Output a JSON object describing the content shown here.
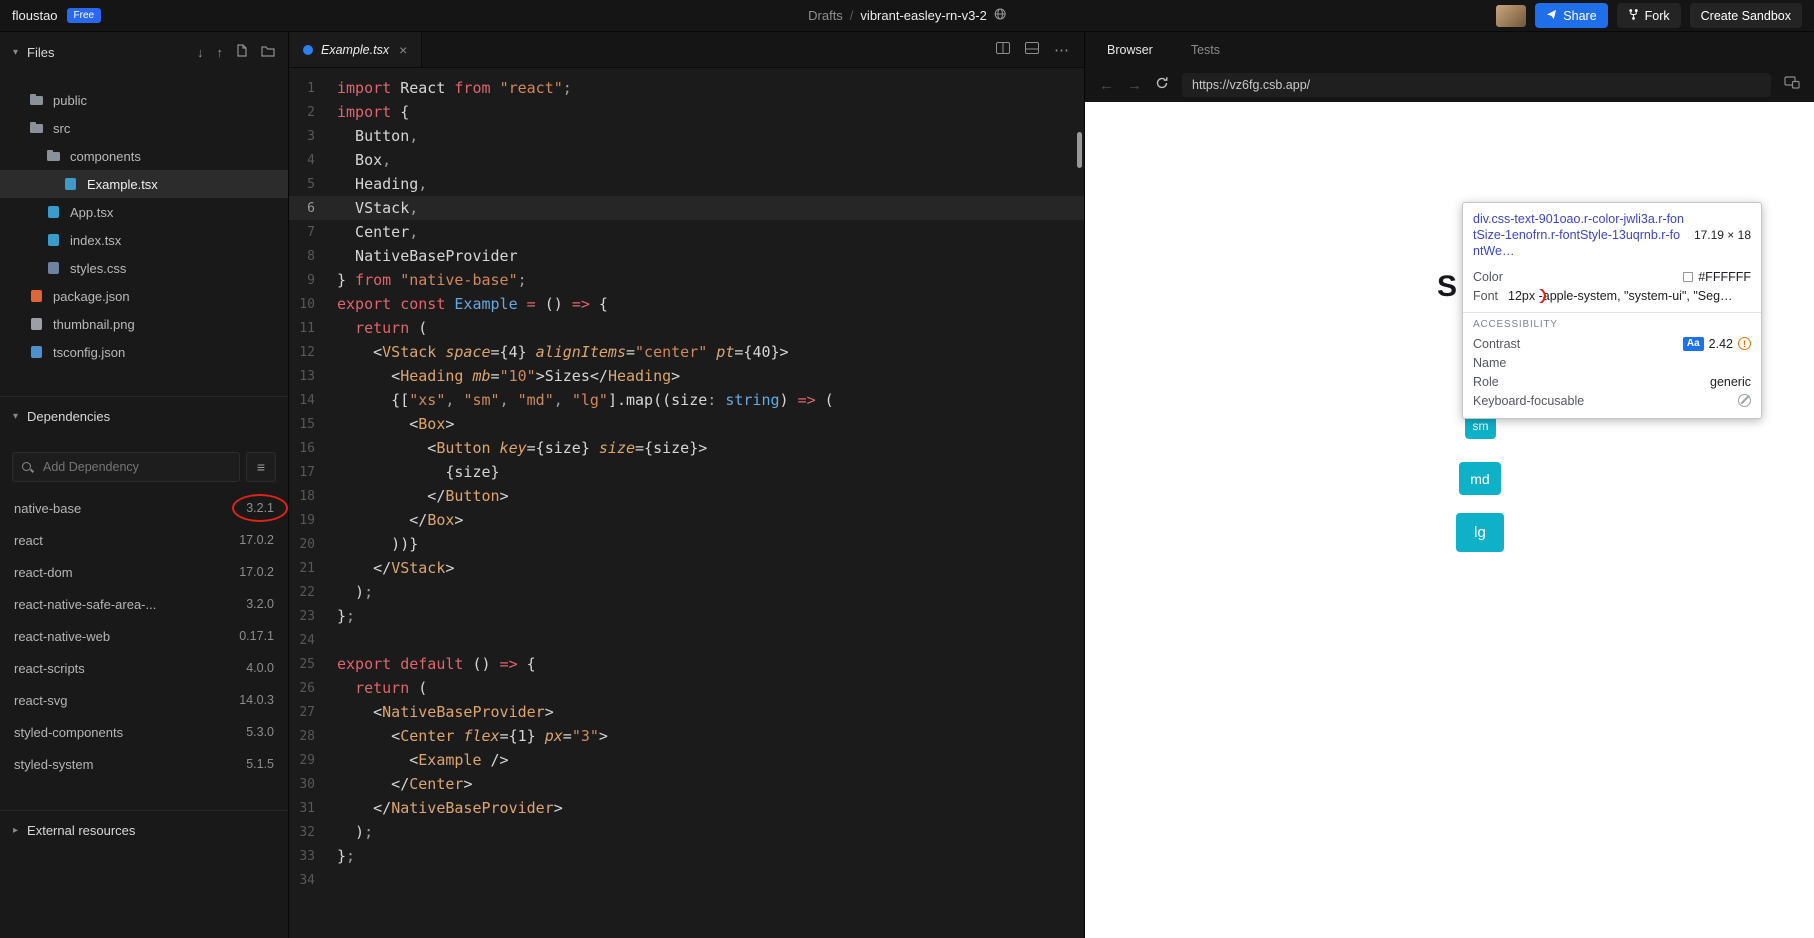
{
  "colors": {
    "accent_blue": "#1f6feb",
    "badge_blue": "#2868f3",
    "button_teal": "#0eb1c7",
    "annotation_red": "#dd2418",
    "selector_blue": "#3b46c4"
  },
  "icons": {
    "chevron_down": "▾",
    "chevron_right": "▸",
    "download": "↓",
    "upload": "↑",
    "menu": "≡",
    "close": "×",
    "more": "⋯",
    "back": "←",
    "forward": "→",
    "warning": "!"
  },
  "topbar": {
    "logo": "floustao",
    "plan_badge": "Free",
    "breadcrumb_parent": "Drafts",
    "breadcrumb_sep": "/",
    "breadcrumb_name": "vibrant-easley-rn-v3-2",
    "share_label": "Share",
    "fork_label": "Fork",
    "create_label": "Create Sandbox"
  },
  "sidebar": {
    "files_header": "Files",
    "files": [
      {
        "label": "public",
        "icon": "folder-icon",
        "indent": 1
      },
      {
        "label": "src",
        "icon": "folder-icon",
        "indent": 1
      },
      {
        "label": "components",
        "icon": "folder-icon",
        "indent": 2
      },
      {
        "label": "Example.tsx",
        "icon": "tsx-file-icon",
        "indent": 3,
        "selected": true
      },
      {
        "label": "App.tsx",
        "icon": "tsx-file-icon",
        "indent": 2
      },
      {
        "label": "index.tsx",
        "icon": "tsx-file-icon",
        "indent": 2
      },
      {
        "label": "styles.css",
        "icon": "css-file-icon",
        "indent": 2
      },
      {
        "label": "package.json",
        "icon": "json-file-icon",
        "indent": 1
      },
      {
        "label": "thumbnail.png",
        "icon": "image-file-icon",
        "indent": 1
      },
      {
        "label": "tsconfig.json",
        "icon": "config-file-icon",
        "indent": 1
      }
    ],
    "dependencies_header": "Dependencies",
    "add_dependency_placeholder": "Add Dependency",
    "dependencies": [
      {
        "name": "native-base",
        "version": "3.2.1",
        "annotated": true
      },
      {
        "name": "react",
        "version": "17.0.2"
      },
      {
        "name": "react-dom",
        "version": "17.0.2"
      },
      {
        "name": "react-native-safe-area-...",
        "version": "3.2.0"
      },
      {
        "name": "react-native-web",
        "version": "0.17.1"
      },
      {
        "name": "react-scripts",
        "version": "4.0.0"
      },
      {
        "name": "react-svg",
        "version": "14.0.3"
      },
      {
        "name": "styled-components",
        "version": "5.3.0"
      },
      {
        "name": "styled-system",
        "version": "5.1.5"
      }
    ],
    "external_resources_header": "External resources"
  },
  "editor": {
    "tab_title": "Example.tsx",
    "active_line": 6,
    "code_lines": [
      {
        "n": 1,
        "tokens": [
          {
            "c": "kw",
            "t": "import"
          },
          {
            "c": "pln",
            "t": " React "
          },
          {
            "c": "kw",
            "t": "from"
          },
          {
            "c": "pln",
            "t": " "
          },
          {
            "c": "str",
            "t": "\"react\""
          },
          {
            "c": "pun",
            "t": ";"
          }
        ]
      },
      {
        "n": 2,
        "tokens": [
          {
            "c": "kw",
            "t": "import"
          },
          {
            "c": "pln",
            "t": " {"
          }
        ]
      },
      {
        "n": 3,
        "tokens": [
          {
            "c": "pln",
            "t": "  Button"
          },
          {
            "c": "pun",
            "t": ","
          }
        ]
      },
      {
        "n": 4,
        "tokens": [
          {
            "c": "pln",
            "t": "  Box"
          },
          {
            "c": "pun",
            "t": ","
          }
        ]
      },
      {
        "n": 5,
        "tokens": [
          {
            "c": "pln",
            "t": "  Heading"
          },
          {
            "c": "pun",
            "t": ","
          }
        ]
      },
      {
        "n": 6,
        "tokens": [
          {
            "c": "pln",
            "t": "  VStack"
          },
          {
            "c": "pun",
            "t": ","
          }
        ]
      },
      {
        "n": 7,
        "tokens": [
          {
            "c": "pln",
            "t": "  Center"
          },
          {
            "c": "pun",
            "t": ","
          }
        ]
      },
      {
        "n": 8,
        "tokens": [
          {
            "c": "pln",
            "t": "  NativeBaseProvider"
          }
        ]
      },
      {
        "n": 9,
        "tokens": [
          {
            "c": "pln",
            "t": "} "
          },
          {
            "c": "kw",
            "t": "from"
          },
          {
            "c": "pln",
            "t": " "
          },
          {
            "c": "str",
            "t": "\"native-base\""
          },
          {
            "c": "pun",
            "t": ";"
          }
        ]
      },
      {
        "n": 10,
        "tokens": [
          {
            "c": "kw",
            "t": "export"
          },
          {
            "c": "pln",
            "t": " "
          },
          {
            "c": "kw",
            "t": "const"
          },
          {
            "c": "pln",
            "t": " "
          },
          {
            "c": "typ",
            "t": "Example"
          },
          {
            "c": "pln",
            "t": " "
          },
          {
            "c": "kw",
            "t": "="
          },
          {
            "c": "pln",
            "t": " () "
          },
          {
            "c": "kw",
            "t": "=>"
          },
          {
            "c": "pln",
            "t": " {"
          }
        ]
      },
      {
        "n": 11,
        "tokens": [
          {
            "c": "pln",
            "t": "  "
          },
          {
            "c": "kw",
            "t": "return"
          },
          {
            "c": "pln",
            "t": " ("
          }
        ]
      },
      {
        "n": 12,
        "tokens": [
          {
            "c": "pln",
            "t": "    <"
          },
          {
            "c": "tag",
            "t": "VStack"
          },
          {
            "c": "att",
            "t": " space"
          },
          {
            "c": "pln",
            "t": "={"
          },
          {
            "c": "num",
            "t": "4"
          },
          {
            "c": "pln",
            "t": "}"
          },
          {
            "c": "att",
            "t": " alignItems"
          },
          {
            "c": "pln",
            "t": "="
          },
          {
            "c": "str",
            "t": "\"center\""
          },
          {
            "c": "att",
            "t": " pt"
          },
          {
            "c": "pln",
            "t": "={"
          },
          {
            "c": "num",
            "t": "40"
          },
          {
            "c": "pln",
            "t": "}>"
          }
        ]
      },
      {
        "n": 13,
        "tokens": [
          {
            "c": "pln",
            "t": "      <"
          },
          {
            "c": "tag",
            "t": "Heading"
          },
          {
            "c": "att",
            "t": " mb"
          },
          {
            "c": "pln",
            "t": "="
          },
          {
            "c": "str",
            "t": "\"10\""
          },
          {
            "c": "pln",
            "t": ">Sizes</"
          },
          {
            "c": "tag",
            "t": "Heading"
          },
          {
            "c": "pln",
            "t": ">"
          }
        ]
      },
      {
        "n": 14,
        "tokens": [
          {
            "c": "pln",
            "t": "      {["
          },
          {
            "c": "str",
            "t": "\"xs\""
          },
          {
            "c": "pun",
            "t": ", "
          },
          {
            "c": "str",
            "t": "\"sm\""
          },
          {
            "c": "pun",
            "t": ", "
          },
          {
            "c": "str",
            "t": "\"md\""
          },
          {
            "c": "pun",
            "t": ", "
          },
          {
            "c": "str",
            "t": "\"lg\""
          },
          {
            "c": "pln",
            "t": "].map((size"
          },
          {
            "c": "pun",
            "t": ": "
          },
          {
            "c": "typ",
            "t": "string"
          },
          {
            "c": "pln",
            "t": ") "
          },
          {
            "c": "kw",
            "t": "=>"
          },
          {
            "c": "pln",
            "t": " ("
          }
        ]
      },
      {
        "n": 15,
        "tokens": [
          {
            "c": "pln",
            "t": "        <"
          },
          {
            "c": "tag",
            "t": "Box"
          },
          {
            "c": "pln",
            "t": ">"
          }
        ]
      },
      {
        "n": 16,
        "tokens": [
          {
            "c": "pln",
            "t": "          <"
          },
          {
            "c": "tag",
            "t": "Button"
          },
          {
            "c": "att",
            "t": " key"
          },
          {
            "c": "pln",
            "t": "={size}"
          },
          {
            "c": "att",
            "t": " size"
          },
          {
            "c": "pln",
            "t": "={size}>"
          }
        ]
      },
      {
        "n": 17,
        "tokens": [
          {
            "c": "pln",
            "t": "            {size}"
          }
        ]
      },
      {
        "n": 18,
        "tokens": [
          {
            "c": "pln",
            "t": "          </"
          },
          {
            "c": "tag",
            "t": "Button"
          },
          {
            "c": "pln",
            "t": ">"
          }
        ]
      },
      {
        "n": 19,
        "tokens": [
          {
            "c": "pln",
            "t": "        </"
          },
          {
            "c": "tag",
            "t": "Box"
          },
          {
            "c": "pln",
            "t": ">"
          }
        ]
      },
      {
        "n": 20,
        "tokens": [
          {
            "c": "pln",
            "t": "      ))}"
          }
        ]
      },
      {
        "n": 21,
        "tokens": [
          {
            "c": "pln",
            "t": "    </"
          },
          {
            "c": "tag",
            "t": "VStack"
          },
          {
            "c": "pln",
            "t": ">"
          }
        ]
      },
      {
        "n": 22,
        "tokens": [
          {
            "c": "pln",
            "t": "  )"
          },
          {
            "c": "pun",
            "t": ";"
          }
        ]
      },
      {
        "n": 23,
        "tokens": [
          {
            "c": "pln",
            "t": "}"
          },
          {
            "c": "pun",
            "t": ";"
          }
        ]
      },
      {
        "n": 24,
        "tokens": []
      },
      {
        "n": 25,
        "tokens": [
          {
            "c": "kw",
            "t": "export"
          },
          {
            "c": "pln",
            "t": " "
          },
          {
            "c": "kw",
            "t": "default"
          },
          {
            "c": "pln",
            "t": " () "
          },
          {
            "c": "kw",
            "t": "=>"
          },
          {
            "c": "pln",
            "t": " {"
          }
        ]
      },
      {
        "n": 26,
        "tokens": [
          {
            "c": "pln",
            "t": "  "
          },
          {
            "c": "kw",
            "t": "return"
          },
          {
            "c": "pln",
            "t": " ("
          }
        ]
      },
      {
        "n": 27,
        "tokens": [
          {
            "c": "pln",
            "t": "    <"
          },
          {
            "c": "tag",
            "t": "NativeBaseProvider"
          },
          {
            "c": "pln",
            "t": ">"
          }
        ]
      },
      {
        "n": 28,
        "tokens": [
          {
            "c": "pln",
            "t": "      <"
          },
          {
            "c": "tag",
            "t": "Center"
          },
          {
            "c": "att",
            "t": " flex"
          },
          {
            "c": "pln",
            "t": "={"
          },
          {
            "c": "num",
            "t": "1"
          },
          {
            "c": "pln",
            "t": "}"
          },
          {
            "c": "att",
            "t": " px"
          },
          {
            "c": "pln",
            "t": "="
          },
          {
            "c": "str",
            "t": "\"3\""
          },
          {
            "c": "pln",
            "t": ">"
          }
        ]
      },
      {
        "n": 29,
        "tokens": [
          {
            "c": "pln",
            "t": "        <"
          },
          {
            "c": "tag",
            "t": "Example"
          },
          {
            "c": "pln",
            "t": " />"
          }
        ]
      },
      {
        "n": 30,
        "tokens": [
          {
            "c": "pln",
            "t": "      </"
          },
          {
            "c": "tag",
            "t": "Center"
          },
          {
            "c": "pln",
            "t": ">"
          }
        ]
      },
      {
        "n": 31,
        "tokens": [
          {
            "c": "pln",
            "t": "    </"
          },
          {
            "c": "tag",
            "t": "NativeBaseProvider"
          },
          {
            "c": "pln",
            "t": ">"
          }
        ]
      },
      {
        "n": 32,
        "tokens": [
          {
            "c": "pln",
            "t": "  )"
          },
          {
            "c": "pun",
            "t": ";"
          }
        ]
      },
      {
        "n": 33,
        "tokens": [
          {
            "c": "pln",
            "t": "}"
          },
          {
            "c": "pun",
            "t": ";"
          }
        ]
      },
      {
        "n": 34,
        "tokens": []
      }
    ]
  },
  "preview": {
    "tab_browser": "Browser",
    "tab_tests": "Tests",
    "url": "https://vz6fg.csb.app/",
    "heading_partial": "S",
    "buttons": [
      {
        "label": "sm"
      },
      {
        "label": "md"
      },
      {
        "label": "lg"
      }
    ],
    "tooltip": {
      "selector": "div.css-text-901oao.r-color-jwli3a.r-fontSize-1enofrn.r-fontStyle-13uqrnb.r-fontWe…",
      "dimensions": "17.19 × 18",
      "color_label": "Color",
      "color_value": "#FFFFFF",
      "font_label": "Font",
      "font_size": "12px",
      "font_rest": " -apple-system, \"system-ui\", \"Seg…",
      "section": "ACCESSIBILITY",
      "contrast_label": "Contrast",
      "contrast_badge": "Aa",
      "contrast_value": "2.42",
      "name_label": "Name",
      "role_label": "Role",
      "role_value": "generic",
      "keyboard_label": "Keyboard-focusable"
    }
  }
}
